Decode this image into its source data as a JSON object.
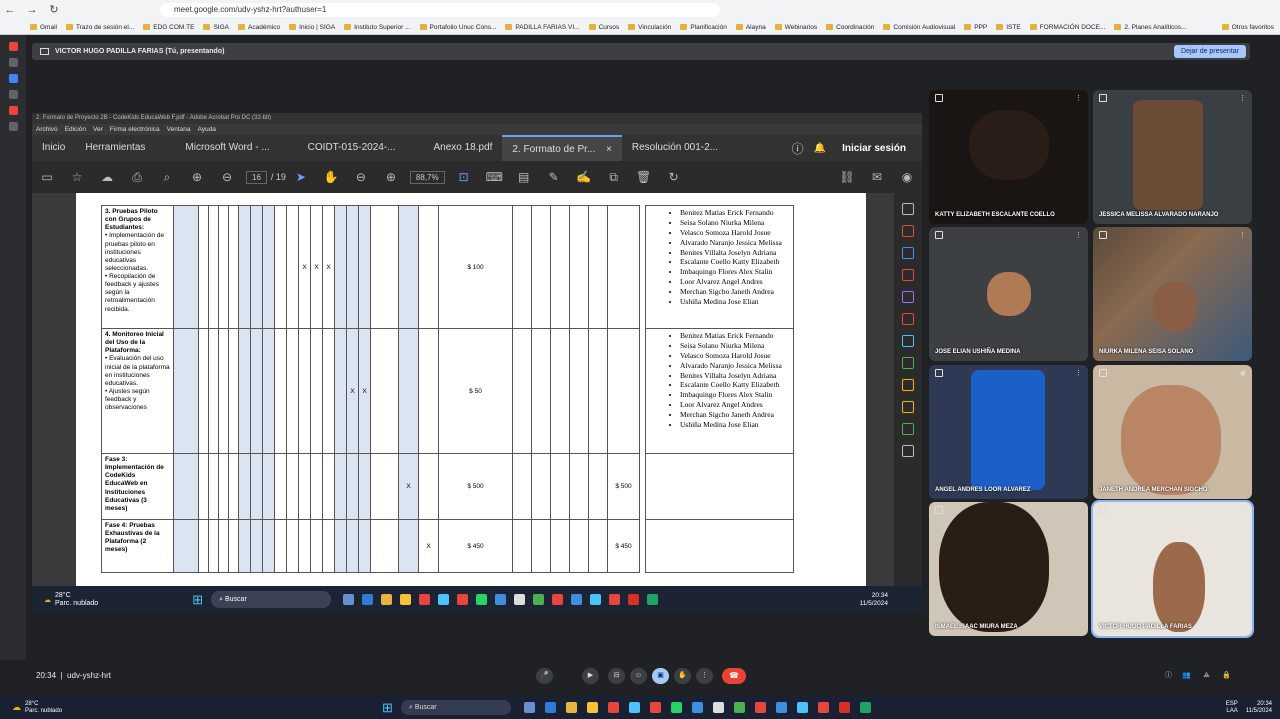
{
  "browser": {
    "url": "meet.google.com/udv-yshz-hrt?authuser=1",
    "bookmarks": [
      "Gmail",
      "Trazo de sesión el...",
      "EDG COM.TE",
      "SIGA",
      "Académico",
      "Inicio | SIGA",
      "Instituto Superior ...",
      "Portafolio Unuc Cons...",
      "PADILLA FARIAS VI...",
      "Cursos",
      "Vinculación",
      "Planificación",
      "Alayna",
      "Webinarios",
      "Coordinación",
      "Comisión Audiovisual",
      "PPP",
      "ISTE",
      "FORMACIÓN DOCE...",
      "2. Planes Analíticos...",
      "Otros favoritos"
    ]
  },
  "meet": {
    "presenter_label": "VICTOR HUGO PADILLA FARIAS (Tú, presentando)",
    "stop_presenting": "Dejar de presentar",
    "time": "20:34",
    "code": "udv-yshz-hrt",
    "participants": [
      {
        "name": "KATTY ELIZABETH ESCALANTE COELLO"
      },
      {
        "name": "JESSICA MELISSA ALVARADO NARANJO"
      },
      {
        "name": "JOSE ELIAN USHIÑA MEDINA"
      },
      {
        "name": "NIURKA MILENA SEISA SOLANO"
      },
      {
        "name": "ANGEL ANDRES LOOR ALVAREZ"
      },
      {
        "name": "JANETH ANDREA MERCHAN SIGCHO"
      },
      {
        "name": "ISMAEL ISAAC MIURA MEZA"
      },
      {
        "name": "VICTOR HUGO PADILLA FARIAS"
      }
    ]
  },
  "acrobat": {
    "title": "2. Formato de Proyecto 2B - CodeKids EducaWeb F.pdf - Adobe Acrobat Pro DC (32-bit)",
    "menu": [
      "Archivo",
      "Edición",
      "Ver",
      "Firma electrónica",
      "Ventana",
      "Ayuda"
    ],
    "tabs": [
      "Inicio",
      "Herramientas",
      "Microsoft Word - ...",
      "COIDT-015-2024-...",
      "Anexo 18.pdf",
      "2. Formato de Pr...",
      "Resolución 001-2..."
    ],
    "sign_in": "Iniciar sesión",
    "page_current": "16",
    "page_total": "/ 19",
    "zoom": "88,7%"
  },
  "table": {
    "rows": [
      {
        "activity": "3. Pruebas Piloto con Grupos de Estudiantes:",
        "details": "• Implementación de pruebas piloto en instituciones educativas seleccionadas.\n• Recopilación de feedback y ajustes según la retroalimentación recibida.",
        "marks": [
          "X",
          "X",
          "X"
        ],
        "cost": "$ 100",
        "total": ""
      },
      {
        "activity": "4. Monitoreo Inicial del Uso de la Plataforma:",
        "details": "• Evaluación del uso inicial de la plataforma en instituciones educativas.\n• Ajustes según feedback y observaciones",
        "marks": [
          "X",
          "X"
        ],
        "cost": "$ 50",
        "total": ""
      },
      {
        "activity": "Fase 3: Implementación de CodeKids EducaWeb en Instituciones Educativas (3 meses)",
        "details": "",
        "marks": [
          "X"
        ],
        "cost": "$ 500",
        "total": "$ 500"
      },
      {
        "activity": "Fase 4: Pruebas Exhaustivas de la Plataforma (2 meses)",
        "details": "",
        "marks": [
          "X"
        ],
        "cost": "$ 450",
        "total": "$ 450"
      }
    ],
    "names": [
      "Benitez Matias Erick Fernando",
      "Seisa Solano Niurka Milena",
      "Velasco Somoza Harold Josue",
      "Alvarado Naranjo Jessica Melissa",
      "Benites Villalta Joselyn Adriana",
      "Escalante Coello Katty Elizabeth",
      "Imbaquingo Flores Alex Stalin",
      "Loor Alvarez Angel Andres",
      "Merchan Sigcho Janeth Andrea",
      "Ushiña Medina Jose Elian"
    ]
  },
  "shared_taskbar": {
    "weather": "28°C",
    "weather_desc": "Parc. nublado",
    "search": "Buscar",
    "time": "20:34",
    "date": "11/5/2024"
  },
  "win_taskbar": {
    "weather": "28°C",
    "weather_desc": "Parc. nublado",
    "search": "Buscar",
    "lang": "ESP",
    "lang2": "LAA",
    "time": "20:34",
    "date": "11/5/2024"
  }
}
